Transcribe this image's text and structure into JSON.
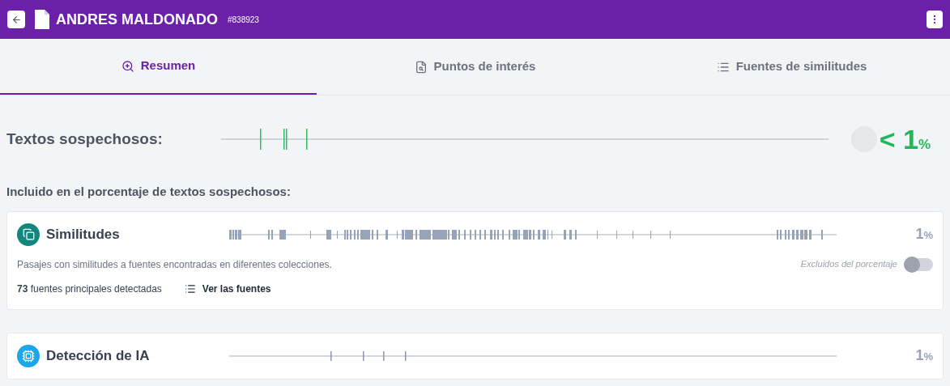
{
  "header": {
    "title": "ANDRES MALDONADO",
    "id": "#838923"
  },
  "tabs": [
    {
      "label": "Resumen",
      "kind": "summary",
      "selected": true
    },
    {
      "label": "Puntos de interés",
      "kind": "points",
      "selected": false
    },
    {
      "label": "Fuentes de similitudes",
      "kind": "sources",
      "selected": false
    }
  ],
  "suspicious": {
    "label": "Textos sospechosos:",
    "prefix": "<",
    "value": "1",
    "unit": "%"
  },
  "section_label": "Incluido en el porcentaje de textos sospechosos:",
  "cards": [
    {
      "kind": "similarity",
      "title": "Similitudes",
      "value": "1",
      "unit": "%",
      "description": "Pasajes con similitudes a fuentes encontradas en diferentes colecciones.",
      "count_text": "**73** fuentes principales detectadas",
      "link": "Ver las fuentes",
      "toggle": {
        "label": "Excluidos del porcentaje",
        "on": false
      }
    },
    {
      "kind": "ai",
      "title": "Detección de IA",
      "value": "1",
      "unit": "%"
    }
  ]
}
